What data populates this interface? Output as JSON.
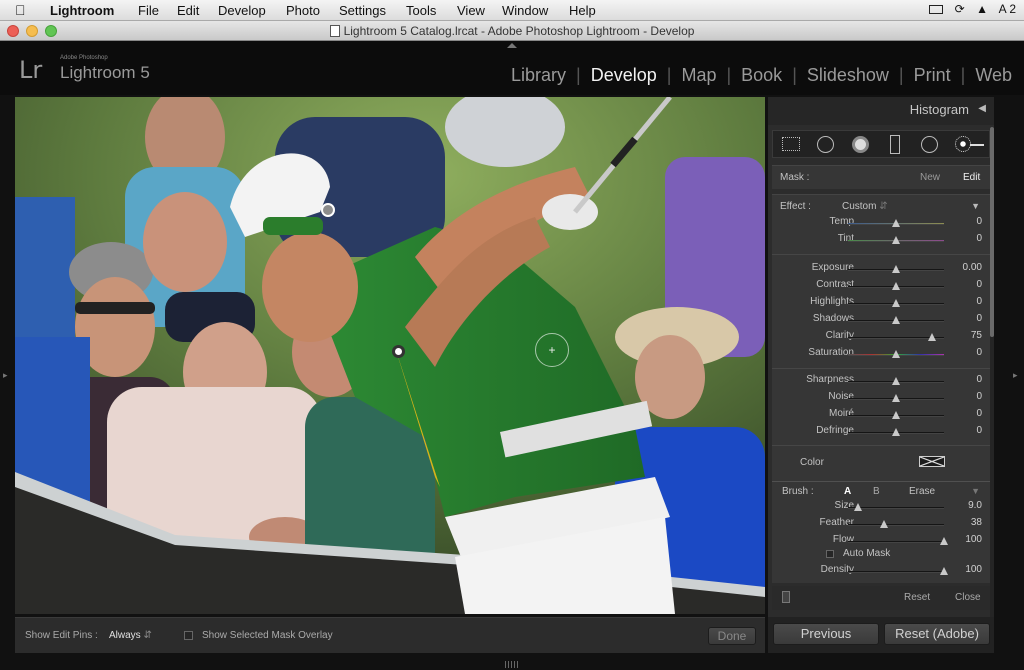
{
  "menubar": {
    "apple": "",
    "app": "Lightroom",
    "items": [
      "File",
      "Edit",
      "Develop",
      "Photo",
      "Settings",
      "Tools",
      "View",
      "Window",
      "Help"
    ],
    "right": "A 2"
  },
  "window": {
    "title": "Lightroom 5 Catalog.lrcat - Adobe Photoshop Lightroom - Develop"
  },
  "identity": {
    "logo": "Lr",
    "vendor": "Adobe Photoshop",
    "product": "Lightroom 5"
  },
  "modules": [
    "Library",
    "Develop",
    "Map",
    "Book",
    "Slideshow",
    "Print",
    "Web"
  ],
  "active_module": "Develop",
  "panel": {
    "header": "Histogram",
    "mask": {
      "label": "Mask :",
      "new": "New",
      "edit": "Edit"
    },
    "effect": {
      "label": "Effect :",
      "preset": "Custom"
    },
    "sliders_a": [
      {
        "label": "Temp",
        "value": "0",
        "pos": 0.5
      },
      {
        "label": "Tint",
        "value": "0",
        "pos": 0.5
      }
    ],
    "sliders_b": [
      {
        "label": "Exposure",
        "value": "0.00",
        "pos": 0.5
      },
      {
        "label": "Contrast",
        "value": "0",
        "pos": 0.5
      },
      {
        "label": "Highlights",
        "value": "0",
        "pos": 0.5
      },
      {
        "label": "Shadows",
        "value": "0",
        "pos": 0.5
      },
      {
        "label": "Clarity",
        "value": "75",
        "pos": 0.875
      },
      {
        "label": "Saturation",
        "value": "0",
        "pos": 0.5
      }
    ],
    "sliders_c": [
      {
        "label": "Sharpness",
        "value": "0",
        "pos": 0.5
      },
      {
        "label": "Noise",
        "value": "0",
        "pos": 0.5
      },
      {
        "label": "Moiré",
        "value": "0",
        "pos": 0.5
      },
      {
        "label": "Defringe",
        "value": "0",
        "pos": 0.5
      }
    ],
    "color_label": "Color",
    "brush": {
      "label": "Brush :",
      "a": "A",
      "b": "B",
      "erase": "Erase"
    },
    "brush_sliders": [
      {
        "label": "Size",
        "value": "9.0",
        "pos": 0.1
      },
      {
        "label": "Feather",
        "value": "38",
        "pos": 0.38
      },
      {
        "label": "Flow",
        "value": "100",
        "pos": 1.0
      }
    ],
    "auto_mask": "Auto Mask",
    "density": {
      "label": "Density",
      "value": "100",
      "pos": 1.0
    },
    "reset": "Reset",
    "close": "Close"
  },
  "toolbar": {
    "pins_label": "Show Edit Pins :",
    "pins_value": "Always",
    "overlay_label": "Show Selected Mask Overlay",
    "done": "Done"
  },
  "bottom": {
    "previous": "Previous",
    "reset": "Reset (Adobe)"
  }
}
